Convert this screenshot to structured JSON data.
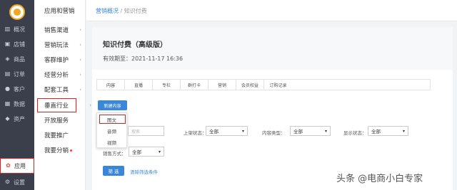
{
  "nav1": {
    "items": [
      {
        "label": "概况",
        "icon": "chart-icon"
      },
      {
        "label": "店铺",
        "icon": "store-icon"
      },
      {
        "label": "商品",
        "icon": "tag-icon"
      },
      {
        "label": "订单",
        "icon": "order-icon"
      },
      {
        "label": "客户",
        "icon": "user-icon"
      },
      {
        "label": "数据",
        "icon": "data-icon"
      },
      {
        "label": "资产",
        "icon": "asset-icon"
      },
      {
        "label": "应用",
        "icon": "apps-icon"
      },
      {
        "label": "设置",
        "icon": "gear-icon"
      }
    ]
  },
  "nav2": {
    "title": "应用和营销",
    "items": [
      {
        "label": "销售渠道",
        "chev": "›"
      },
      {
        "label": "营销玩法",
        "chev": "›"
      },
      {
        "label": "客群维护",
        "chev": "›"
      },
      {
        "label": "经营分析",
        "chev": "›"
      },
      {
        "label": "配套工具",
        "chev": "›"
      },
      {
        "label": "垂直行业",
        "chev": "›"
      },
      {
        "label": "开放服务",
        "chev": ""
      },
      {
        "label": "我要推广",
        "chev": ""
      },
      {
        "label": "我要分销",
        "chev": ""
      }
    ]
  },
  "breadcrumb": {
    "parent": "营销概况",
    "sep": "/",
    "current": "知识付费"
  },
  "page": {
    "title": "知识付费（高级版）",
    "expire": "有效期至：2021-11-17 16:36"
  },
  "tabs": [
    "内容",
    "直播",
    "专栏",
    "群打卡",
    "营销",
    "会员权益",
    "订购记录"
  ],
  "new_button": "新建内容",
  "new_menu": [
    "图文",
    "音频",
    "视频"
  ],
  "filters": {
    "search_placeholder": "搜索",
    "status_label": "上架状态：",
    "status_value": "全部",
    "type_label": "内容类型：",
    "type_value": "全部",
    "display_label": "显示状态：",
    "display_value": "全部",
    "sale_label": "销售方式：",
    "sale_value": "全部",
    "caret": "▾"
  },
  "filter_button": "筛 选",
  "clear_link": "清除筛选条件",
  "watermark": "头条 @电商小白专家"
}
